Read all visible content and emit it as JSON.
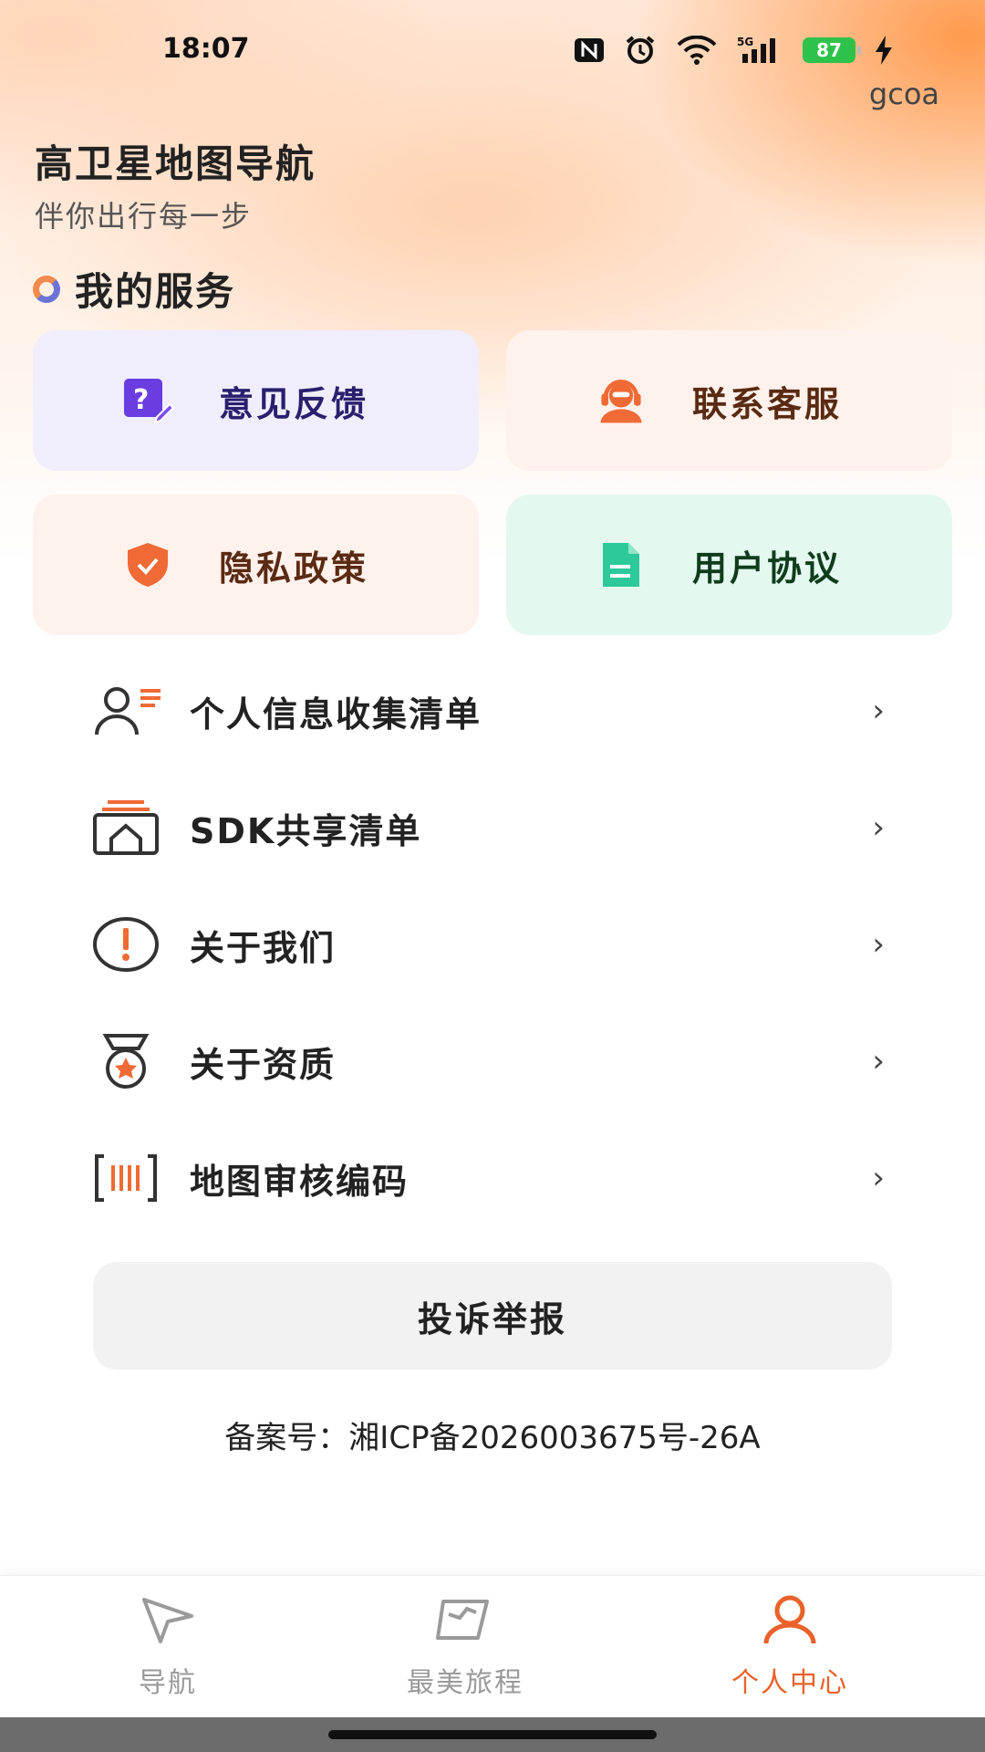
{
  "status_bar": {
    "time": "18:07",
    "battery": "87"
  },
  "user": "gcoa",
  "app": {
    "title": "高卫星地图导航",
    "subtitle": "伴你出行每一步"
  },
  "services": {
    "title": "我的服务",
    "cards": [
      {
        "label": "意见反馈",
        "icon": "feedback-icon",
        "bg": "#f0eefd",
        "color": "#2a1f6e"
      },
      {
        "label": "联系客服",
        "icon": "customer-service-icon",
        "bg": "#fff1ec",
        "color": "#5a2a12"
      },
      {
        "label": "隐私政策",
        "icon": "privacy-shield-icon",
        "bg": "#fff1ec",
        "color": "#5a2a12"
      },
      {
        "label": "用户协议",
        "icon": "document-icon",
        "bg": "#e4f8f0",
        "color": "#0f3d1c"
      }
    ]
  },
  "menu": [
    {
      "label": "个人信息收集清单",
      "icon": "personal-info-list-icon"
    },
    {
      "label": "SDK共享清单",
      "icon": "sdk-share-icon"
    },
    {
      "label": "关于我们",
      "icon": "info-exclamation-icon"
    },
    {
      "label": "关于资质",
      "icon": "medal-icon"
    },
    {
      "label": "地图审核编码",
      "icon": "barcode-icon"
    }
  ],
  "report_button": "投诉举报",
  "icp": "备案号：湘ICP备2026003675号-26A",
  "tabs": [
    {
      "label": "导航",
      "icon": "navigation-arrow-icon",
      "active": false
    },
    {
      "label": "最美旅程",
      "icon": "flag-icon",
      "active": false
    },
    {
      "label": "个人中心",
      "icon": "person-icon",
      "active": true
    }
  ],
  "colors": {
    "accent": "#e8622a",
    "inactive": "#9a9a9a"
  }
}
